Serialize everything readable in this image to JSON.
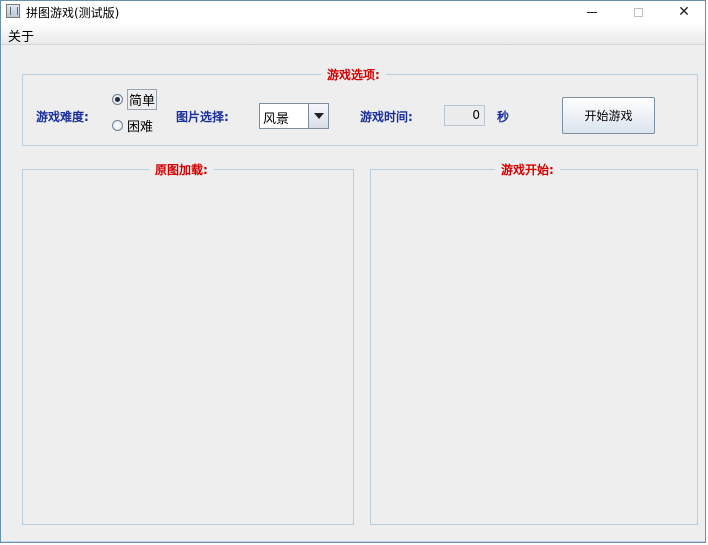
{
  "window": {
    "title": "拼图游戏(测试版)",
    "controls": {
      "minimize": "minimize",
      "maximize": "maximize",
      "close": "✕"
    }
  },
  "menu": {
    "items": [
      "关于"
    ]
  },
  "options_panel": {
    "title": "游戏选项:",
    "difficulty": {
      "label": "游戏难度:",
      "options": [
        {
          "label": "简单",
          "selected": true
        },
        {
          "label": "困难",
          "selected": false
        }
      ]
    },
    "image_select": {
      "label": "图片选择:",
      "value": "风景"
    },
    "game_time": {
      "label": "游戏时间:",
      "value": "0",
      "unit": "秒"
    },
    "start_button": "开始游戏"
  },
  "original_panel": {
    "title": "原图加载:"
  },
  "game_panel": {
    "title": "游戏开始:"
  },
  "colors": {
    "group_title": "#d40000",
    "label": "#1a2f9a",
    "group_border": "#b8cfe0",
    "background": "#eeeeee"
  }
}
